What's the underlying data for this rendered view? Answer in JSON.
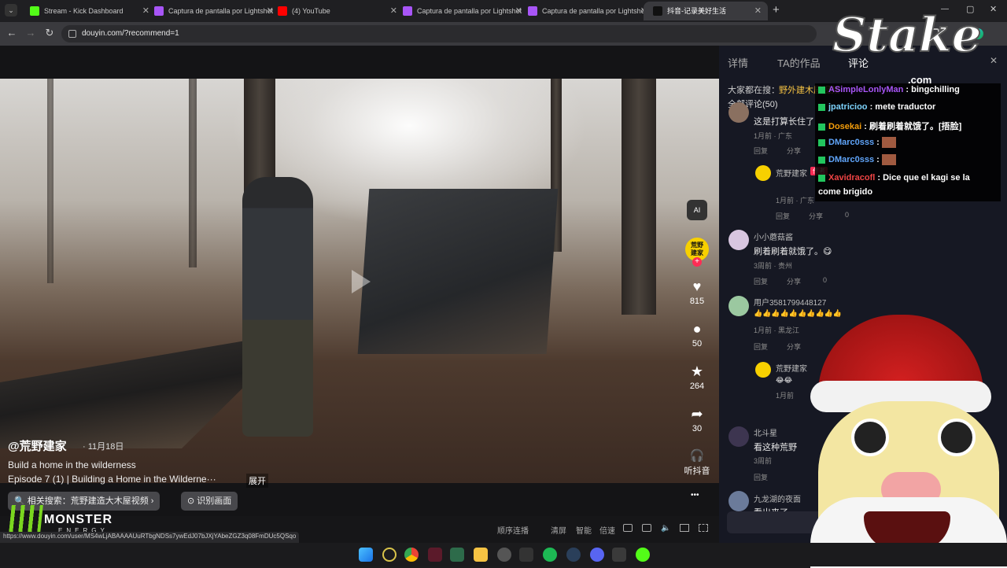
{
  "tabs": [
    {
      "title": "Stream - Kick Dashboard",
      "fav_color": "#53fc18"
    },
    {
      "title": "Captura de pantalla por Lightshot",
      "fav_color": "#a855f7"
    },
    {
      "title": "(4) YouTube",
      "fav_color": "#ff0000"
    },
    {
      "title": "Captura de pantalla por Lightshot",
      "fav_color": "#a855f7"
    },
    {
      "title": "Captura de pantalla por Lightshot",
      "fav_color": "#a855f7"
    },
    {
      "title": "抖音-记录美好生活",
      "fav_color": "#111111"
    }
  ],
  "tab_close": "✕",
  "new_tab": "+",
  "window_controls": {
    "min": "—",
    "max": "▢",
    "close": "✕"
  },
  "address": {
    "url": "douyin.com/?recommend=1"
  },
  "nav_icons": {
    "back": "←",
    "forward": "→",
    "reload": "↻"
  },
  "video": {
    "author": "@荒野建家",
    "date": "· 11月18日",
    "desc_line1": "Build a home in the wilderness",
    "desc_line2": "Episode 7 (1) | Building a Home in the Wilderne···",
    "expand": "展开",
    "related_search": "🔍 相关搜索：荒野建造大木屋视频 ›",
    "identify": "⊙ 识别画面",
    "status_url": "https://www.douyin.com/user/MS4wLjABAAAAUuRTbgNDSs7ywEdJ07bJXjYAbeZGZ3q08FmDUc5QSqo"
  },
  "actions": {
    "ai_label": "AI",
    "author_badge": "荒野\n建家",
    "likes": "815",
    "comments": "50",
    "favorites": "264",
    "shares": "30",
    "listen": "听抖音",
    "more": "•••"
  },
  "controls": {
    "autoplay": "顺序连播",
    "clear": "清屏",
    "smart": "智能",
    "speed": "倍速"
  },
  "side": {
    "tabs": [
      "详情",
      "TA的作品",
      "评论"
    ],
    "search_prefix": "大家都在搜：",
    "search_term": "野外建木屋视频",
    "all_comments": "全部评论(50)",
    "comments": [
      {
        "name": "",
        "text": "这是打算长住了",
        "meta": "1月前 · 广东"
      },
      {
        "name": "荒野建家",
        "tag": "作者",
        "text": "",
        "meta": "1月前 · 广东",
        "likes": "0"
      },
      {
        "name": "小小蘑菇酱",
        "text": "刷着刷着就饿了。😋",
        "meta": "3周前 · 贵州",
        "likes": "0"
      },
      {
        "name": "用户3581799448127",
        "text": "👍👍👍👍👍👍👍👍👍👍",
        "meta": "1月前 · 黑龙江"
      },
      {
        "name": "荒野建家",
        "tag": "作者",
        "text": "😂😂",
        "meta": "1月前"
      },
      {
        "name": "北斗星",
        "text": "看这种荒野",
        "meta": "3周前"
      },
      {
        "name": "九龙湖的夜面",
        "text": "看出来了",
        "meta": ""
      }
    ],
    "reply": "回复",
    "share": "分享",
    "zero": "0"
  },
  "chat": [
    {
      "user": "ASimpleLonlyMan",
      "msg": "bingchilling",
      "color": "#a855f7"
    },
    {
      "user": "jpatricioo",
      "msg": "mete traductor",
      "color": "#7dd3fc"
    },
    {
      "user": "Dosekai",
      "msg": "刷着刷着就饿了。[捂脸]",
      "color": "#f59e0b"
    },
    {
      "user": "DMarc0sss",
      "msg": "",
      "color": "#60a5fa"
    },
    {
      "user": "DMarc0sss",
      "msg": "",
      "color": "#60a5fa"
    },
    {
      "user": "Xavidracofl",
      "msg": "Dice que el kagi se la",
      "color": "#ef4444"
    }
  ],
  "chat_wrap": "come brigido",
  "stake_logo": "Stake",
  "stake_tld": ".com",
  "monster_logo": "MONSTER",
  "monster_sub": "ENERGY"
}
